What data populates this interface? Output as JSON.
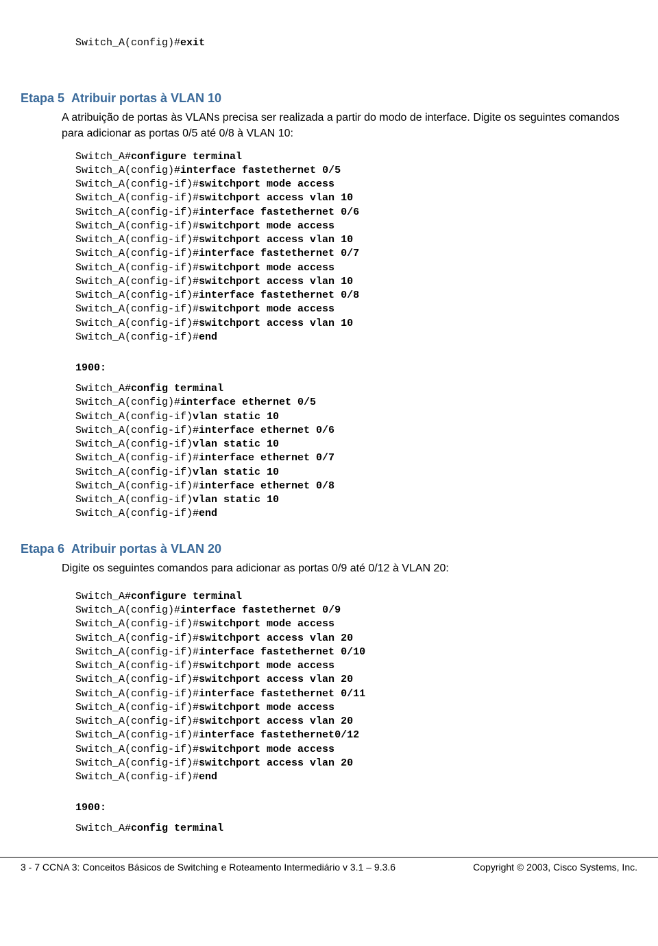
{
  "top": {
    "line1_prompt": "Switch_A(config)#",
    "line1_cmd": "exit"
  },
  "etapa5": {
    "heading_label": "Etapa 5",
    "heading_title": "Atribuir portas à VLAN 10",
    "para": "A atribuição de portas às VLANs precisa ser realizada a partir do modo de interface. Digite os seguintes comandos para adicionar as portas 0/5 até 0/8 à VLAN 10:",
    "lines": [
      {
        "prompt": "Switch_A#",
        "cmd": "configure terminal"
      },
      {
        "prompt": "Switch_A(config)#",
        "cmd": "interface fastethernet 0/5"
      },
      {
        "prompt": "Switch_A(config-if)#",
        "cmd": "switchport mode access"
      },
      {
        "prompt": "Switch_A(config-if)#",
        "cmd": "switchport access vlan 10"
      },
      {
        "prompt": "Switch_A(config-if)#",
        "cmd": "interface fastethernet 0/6"
      },
      {
        "prompt": "Switch_A(config-if)#",
        "cmd": "switchport mode access"
      },
      {
        "prompt": "Switch_A(config-if)#",
        "cmd": "switchport access vlan 10"
      },
      {
        "prompt": "Switch_A(config-if)#",
        "cmd": "interface fastethernet 0/7"
      },
      {
        "prompt": "Switch_A(config-if)#",
        "cmd": "switchport mode access"
      },
      {
        "prompt": "Switch_A(config-if)#",
        "cmd": "switchport access vlan 10"
      },
      {
        "prompt": "Switch_A(config-if)#",
        "cmd": "interface fastethernet 0/8"
      },
      {
        "prompt": "Switch_A(config-if)#",
        "cmd": "switchport mode access"
      },
      {
        "prompt": "Switch_A(config-if)#",
        "cmd": "switchport access vlan 10"
      },
      {
        "prompt": "Switch_A(config-if)#",
        "cmd": "end"
      }
    ],
    "sub_label": "1900:",
    "sub_lines": [
      {
        "prompt": "Switch_A#",
        "cmd": "config terminal"
      },
      {
        "prompt": "Switch_A(config)#",
        "cmd": "interface ethernet 0/5"
      },
      {
        "prompt": "Switch_A(config-if)",
        "cmd": "vlan static 10"
      },
      {
        "prompt": "Switch_A(config-if)#",
        "cmd": "interface ethernet 0/6"
      },
      {
        "prompt": "Switch_A(config-if)",
        "cmd": "vlan static 10"
      },
      {
        "prompt": "Switch_A(config-if)#",
        "cmd": "interface ethernet 0/7"
      },
      {
        "prompt": "Switch_A(config-if)",
        "cmd": "vlan static 10"
      },
      {
        "prompt": "Switch_A(config-if)#",
        "cmd": "interface ethernet 0/8"
      },
      {
        "prompt": "Switch_A(config-if)",
        "cmd": "vlan static 10"
      },
      {
        "prompt": "Switch_A(config-if)#",
        "cmd": "end"
      }
    ]
  },
  "etapa6": {
    "heading_label": "Etapa 6",
    "heading_title": "Atribuir portas à VLAN 20",
    "para": "Digite os seguintes comandos para adicionar as portas 0/9 até 0/12 à VLAN 20:",
    "lines": [
      {
        "prompt": "Switch_A#",
        "cmd": "configure terminal"
      },
      {
        "prompt": "Switch_A(config)#",
        "cmd": "interface fastethernet 0/9"
      },
      {
        "prompt": "Switch_A(config-if)#",
        "cmd": "switchport mode access"
      },
      {
        "prompt": "Switch_A(config-if)#",
        "cmd": "switchport access vlan 20"
      },
      {
        "prompt": "Switch_A(config-if)#",
        "cmd": "interface fastethernet 0/10"
      },
      {
        "prompt": "Switch_A(config-if)#",
        "cmd": "switchport mode access"
      },
      {
        "prompt": "Switch_A(config-if)#",
        "cmd": "switchport access vlan 20"
      },
      {
        "prompt": "Switch_A(config-if)#",
        "cmd": "interface fastethernet 0/11"
      },
      {
        "prompt": "Switch_A(config-if)#",
        "cmd": "switchport mode access"
      },
      {
        "prompt": "Switch_A(config-if)#",
        "cmd": "switchport access vlan 20"
      },
      {
        "prompt": "Switch_A(config-if)#",
        "cmd": "interface fastethernet0/12"
      },
      {
        "prompt": "Switch_A(config-if)#",
        "cmd": "switchport mode access"
      },
      {
        "prompt": "Switch_A(config-if)#",
        "cmd": "switchport access vlan 20"
      },
      {
        "prompt": "Switch_A(config-if)#",
        "cmd": "end"
      }
    ],
    "sub_label": "1900:",
    "sub_lines": [
      {
        "prompt": "Switch_A#",
        "cmd": "config terminal"
      }
    ]
  },
  "footer": {
    "left": "3 - 7    CCNA 3: Conceitos Básicos de Switching e Roteamento Intermediário v 3.1 – 9.3.6",
    "right": "Copyright © 2003, Cisco Systems, Inc."
  }
}
